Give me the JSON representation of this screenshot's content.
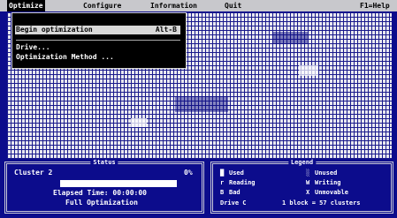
{
  "menubar": {
    "items": [
      {
        "label": "Optimize",
        "hot": "O"
      },
      {
        "label": "Configure",
        "hot": "C"
      },
      {
        "label": "Information",
        "hot": "I"
      },
      {
        "label": "Quit",
        "hot": "Q"
      }
    ],
    "help": "F1=Help"
  },
  "dropdown": {
    "begin": {
      "label": "Begin optimization",
      "shortcut": "Alt-B"
    },
    "drive": "Drive...",
    "method": "Optimization Method ..."
  },
  "status": {
    "title": "Status",
    "cluster": "Cluster 2",
    "percent_label": "0%",
    "progress": 0,
    "elapsed": "Elapsed Time: 00:00:00",
    "method": "Full Optimization"
  },
  "legend": {
    "title": "Legend",
    "left": [
      {
        "sym": "█",
        "text": "Used"
      },
      {
        "sym": "r",
        "text": "Reading"
      },
      {
        "sym": "B",
        "text": "Bad"
      }
    ],
    "right": [
      {
        "sym": "░",
        "text": "Unused"
      },
      {
        "sym": "W",
        "text": "Writing"
      },
      {
        "sym": "X",
        "text": "Unmovable"
      }
    ],
    "drive": "Drive C",
    "block": "1 block = 57 clusters"
  },
  "colors": {
    "background": "#0c0c8c",
    "menubar": "#c8c8cc",
    "map_light": "#e8e8f0"
  }
}
